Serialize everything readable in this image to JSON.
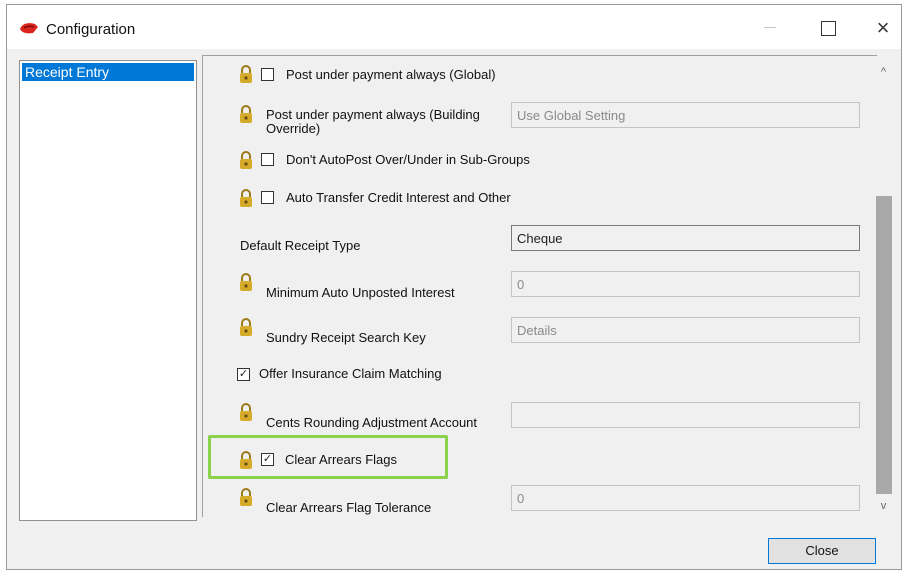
{
  "window": {
    "title": "Configuration",
    "close_glyph": "×"
  },
  "nav": {
    "items": [
      {
        "label": "Receipt Entry",
        "selected": true
      }
    ]
  },
  "settings": {
    "post_under_global": {
      "label": "Post under payment always (Global)",
      "checked": false,
      "icon": "lock-icon"
    },
    "post_under_building": {
      "label": "Post under payment always (Building Override)",
      "value": "Use Global Setting",
      "icon": "lock-icon"
    },
    "dont_autopost": {
      "label": "Don't AutoPost Over/Under in Sub-Groups",
      "checked": false,
      "icon": "lock-icon"
    },
    "auto_transfer": {
      "label": "Auto Transfer Credit Interest and Other",
      "checked": false,
      "icon": "lock-icon"
    },
    "default_receipt_type": {
      "label": "Default Receipt Type",
      "value": "Cheque"
    },
    "min_auto_unposted": {
      "label": "Minimum Auto Unposted Interest",
      "value": "0",
      "icon": "lock-icon"
    },
    "sundry_search_key": {
      "label": "Sundry Receipt Search Key",
      "value": "Details",
      "icon": "lock-icon"
    },
    "offer_insurance": {
      "label": "Offer Insurance Claim Matching",
      "checked": true,
      "check_glyph": "✓"
    },
    "cents_rounding": {
      "label": "Cents Rounding Adjustment Account",
      "value": "",
      "icon": "lock-icon"
    },
    "clear_arrears_flags": {
      "label": "Clear Arrears Flags",
      "checked": true,
      "check_glyph": "✓",
      "icon": "lock-icon",
      "highlight_color": "#8bd14b"
    },
    "clear_arrears_tolerance": {
      "label": "Clear Arrears Flag Tolerance",
      "value": "0",
      "icon": "lock-icon"
    }
  },
  "scrollbar": {
    "up_glyph": "^",
    "down_glyph": "v"
  },
  "footer": {
    "close_label": "Close"
  },
  "colors": {
    "accent": "#0078d7",
    "lock": "#c9a227"
  }
}
